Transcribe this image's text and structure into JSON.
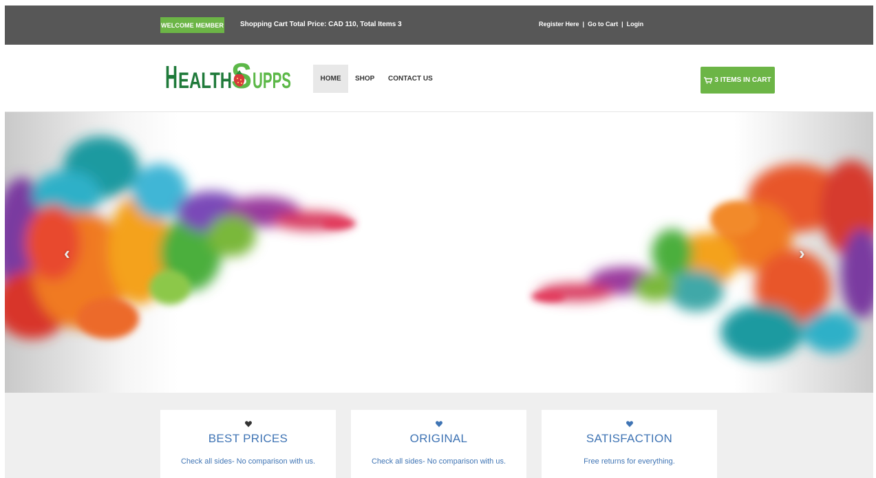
{
  "topbar": {
    "welcome_label": "WELCOME MEMBER",
    "cart_summary": "Shopping Cart Total Price: CAD 110, Total Items 3",
    "links": [
      "Register Here",
      "Go to Cart",
      "Login"
    ],
    "separator": "|"
  },
  "header": {
    "logo_text": "HEALTHSUPPS",
    "nav": {
      "home": "HOME",
      "shop": "SHOP",
      "contact": "CONTACT US",
      "active": "HOME"
    },
    "cart_button_label": "3 ITEMS IN CART",
    "cart_icon": "shopping-cart-icon"
  },
  "hero": {
    "prev_icon": "chevron-left-icon",
    "next_icon": "chevron-right-icon",
    "prev_glyph": "‹",
    "next_glyph": "›"
  },
  "features": [
    {
      "icon": "heart-icon",
      "icon_color": "#333333",
      "title": "BEST PRICES",
      "description": "Check all sides- No comparison with us."
    },
    {
      "icon": "heart-icon",
      "icon_color": "#3f74b4",
      "title": "ORIGINAL",
      "description": "Check all sides- No comparison with us."
    },
    {
      "icon": "heart-icon",
      "icon_color": "#3f74b4",
      "title": "SATISFACTION",
      "description": "Free returns for everything."
    }
  ],
  "colors": {
    "topbar": "#575757",
    "accent_green": "#6cb546",
    "accent_blue": "#3f74b4",
    "logo_green": "#1f7a3a",
    "logo_light_green": "#5cb848"
  }
}
